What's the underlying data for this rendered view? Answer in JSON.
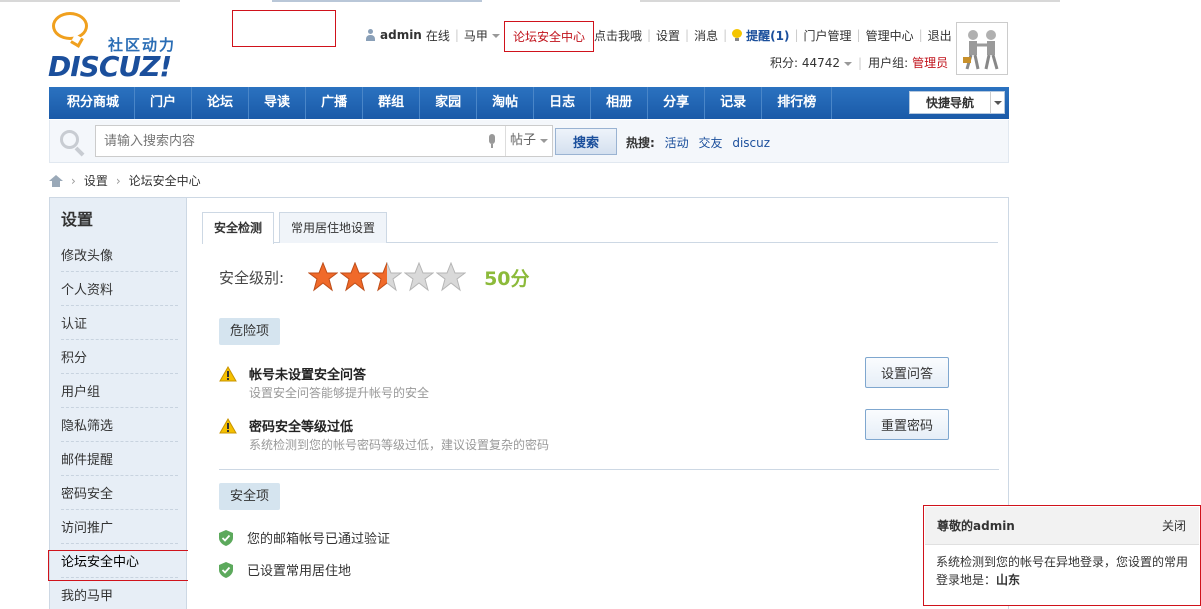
{
  "logo": {
    "cn_text": "社区动力",
    "en_text": "DISCUZ!"
  },
  "userbar": {
    "username": "admin",
    "online": "在线",
    "alias": "马甲",
    "safety_center": "论坛安全中心",
    "ping": "点击我哦",
    "settings": "设置",
    "messages": "消息",
    "remind": "提醒(1)",
    "portal_manage": "门户管理",
    "admin_center": "管理中心",
    "logout": "退出",
    "credits_label": "积分: 44742",
    "group_label": "用户组:",
    "group_value": "管理员"
  },
  "nav": {
    "items": [
      "积分商城",
      "门户",
      "论坛",
      "导读",
      "广播",
      "群组",
      "家园",
      "淘帖",
      "日志",
      "相册",
      "分享",
      "记录",
      "排行榜"
    ],
    "quick": "快捷导航"
  },
  "search": {
    "placeholder": "请输入搜索内容",
    "type": "帖子",
    "button": "搜索",
    "hot_label": "热搜:",
    "hot_items": [
      "活动",
      "交友",
      "discuz"
    ]
  },
  "breadcrumb": {
    "items": [
      "设置",
      "论坛安全中心"
    ]
  },
  "sidebar": {
    "title": "设置",
    "items": [
      "修改头像",
      "个人资料",
      "认证",
      "积分",
      "用户组",
      "隐私筛选",
      "邮件提醒",
      "密码安全",
      "访问推广",
      "论坛安全中心",
      "我的马甲"
    ]
  },
  "tabs": {
    "security_check": "安全检测",
    "residence": "常用居住地设置"
  },
  "security": {
    "level_label": "安全级别:",
    "stars_filled": 2.5,
    "stars_total": 5,
    "score": "50分",
    "danger_label": "危险项",
    "risks": [
      {
        "title": "帐号未设置安全问答",
        "desc": "设置安全问答能够提升帐号的安全",
        "button": "设置问答"
      },
      {
        "title": "密码安全等级过低",
        "desc": "系统检测到您的帐号密码等级过低，建议设置复杂的密码",
        "button": "重置密码"
      }
    ],
    "safe_label": "安全项",
    "safe_items": [
      "您的邮箱帐号已通过验证",
      "已设置常用居住地"
    ]
  },
  "popup": {
    "title": "尊敬的admin",
    "close": "关闭",
    "message": "系统检测到您的帐号在异地登录，您设置的常用登录地是：",
    "place": "山东"
  },
  "colors": {
    "nav_blue": "#1a5aa8",
    "highlight_red": "#d0121b",
    "score_green": "#8cba3a",
    "star_orange": "#f06a2a"
  }
}
